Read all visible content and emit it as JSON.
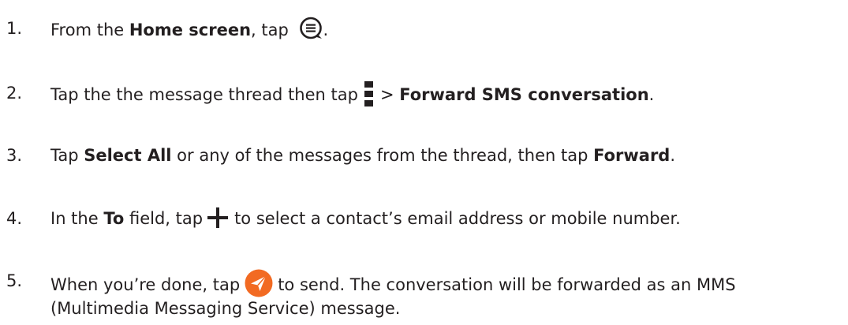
{
  "steps": [
    {
      "num": "1.",
      "a": "From the ",
      "b1": "Home screen",
      "c": ", tap ",
      "icon": "messaging-app-icon",
      "d": "."
    },
    {
      "num": "2.",
      "a": "Tap the the message thread then tap",
      "icon": "more-options-icon",
      "c": "> ",
      "b1": "Forward SMS conversation",
      "d": "."
    },
    {
      "num": "3.",
      "a": "Tap ",
      "b1": "Select All",
      "c": " or any of the  messages from the thread, then tap ",
      "b2": "Forward",
      "d": "."
    },
    {
      "num": "4.",
      "a": "In the ",
      "b1": "To",
      "c": " field, tap",
      "icon": "plus-icon",
      "d": "to select a contact’s email address or mobile number."
    },
    {
      "num": "5.",
      "a": "When you’re done, tap",
      "icon": "send-icon",
      "d": "to send. The conversation will be forwarded as an MMS",
      "line2": "(Multimedia Messaging Service) message."
    }
  ],
  "colors": {
    "text": "#231f20",
    "send_button": "#f26a22"
  }
}
